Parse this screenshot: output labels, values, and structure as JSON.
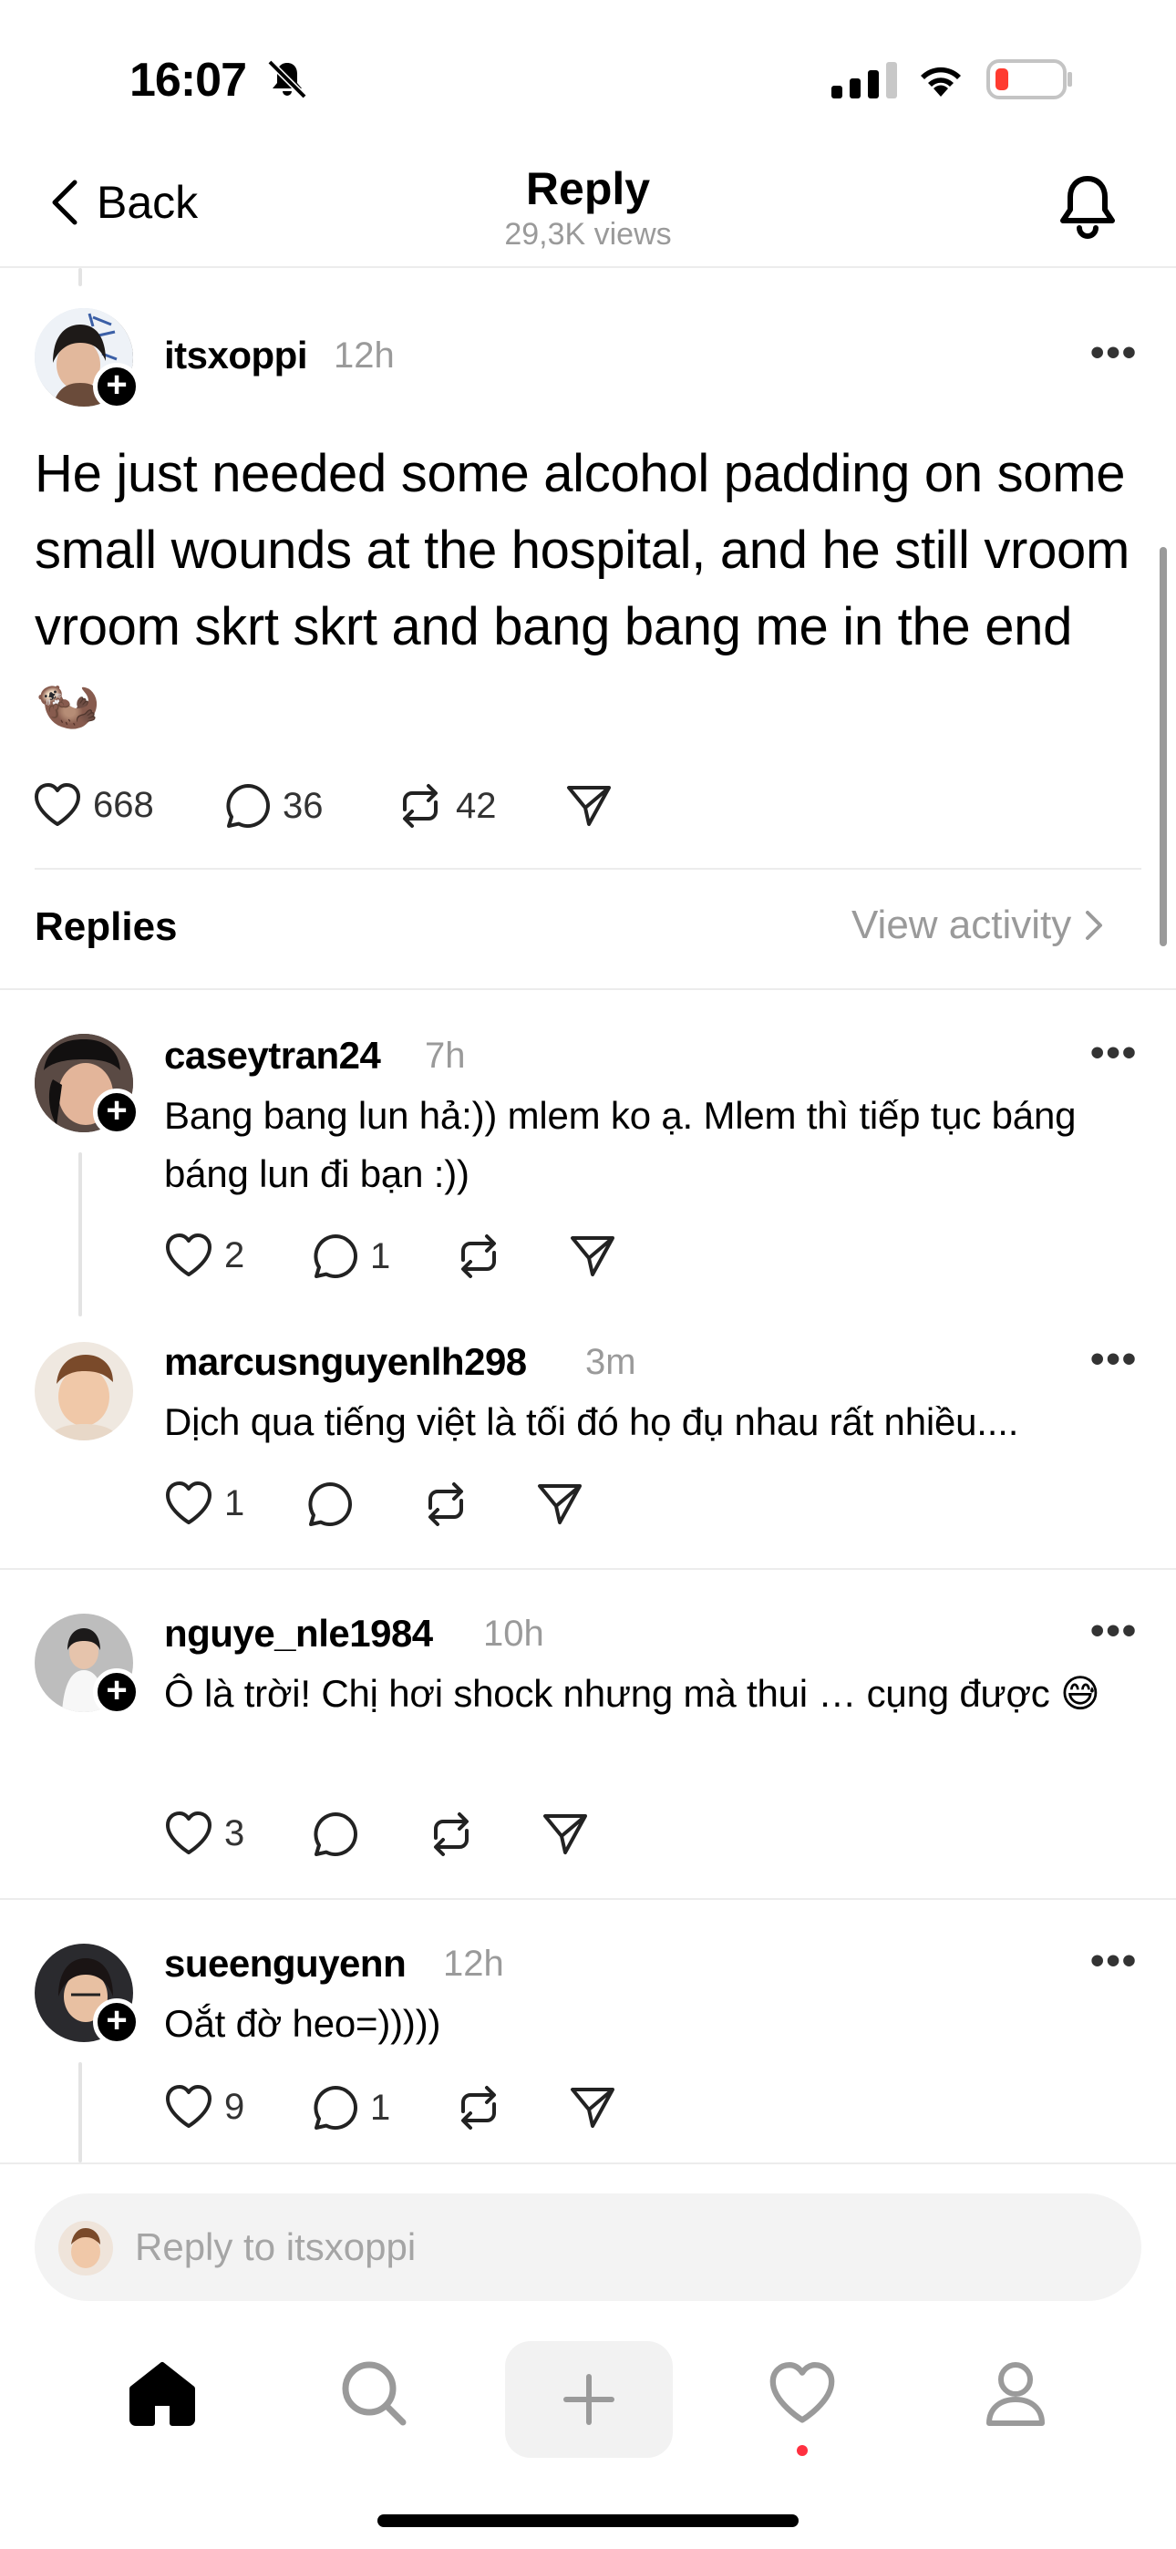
{
  "status_bar": {
    "time": "16:07"
  },
  "header": {
    "back_label": "Back",
    "title": "Reply",
    "subtitle": "29,3K views"
  },
  "post": {
    "username": "itsxoppi",
    "time": "12h",
    "text": "He just needed some alcohol padding on some small wounds at the hospital, and he still vroom vroom skrt skrt and bang bang me in the end 🦦",
    "likes": "668",
    "comments": "36",
    "reposts": "42"
  },
  "replies_section": {
    "label": "Replies",
    "view_activity": "View activity"
  },
  "replies": [
    {
      "username": "caseytran24",
      "time": "7h",
      "text": "Bang bang lun hả:)) mlem ko ạ. Mlem thì tiếp tục báng báng lun đi bạn :))",
      "likes": "2",
      "comments": "1",
      "reposts": ""
    },
    {
      "username": "marcusnguyenlh298",
      "time": "3m",
      "text": "Dịch qua tiếng việt là tối đó họ đụ nhau rất nhiều....",
      "likes": "1",
      "comments": "",
      "reposts": ""
    },
    {
      "username": "nguye_nle1984",
      "time": "10h",
      "text": "Ô là trời! Chị hơi shock nhưng mà thui … cụng được 😅",
      "likes": "3",
      "comments": "",
      "reposts": ""
    },
    {
      "username": "sueenguyenn",
      "time": "12h",
      "text": "Oắt đờ heo=)))))",
      "likes": "9",
      "comments": "1",
      "reposts": ""
    }
  ],
  "reply_input": {
    "placeholder": "Reply to itsxoppi"
  },
  "nav": {
    "items": [
      "home-icon",
      "search-icon",
      "plus-icon",
      "heart-icon",
      "profile-icon"
    ]
  }
}
